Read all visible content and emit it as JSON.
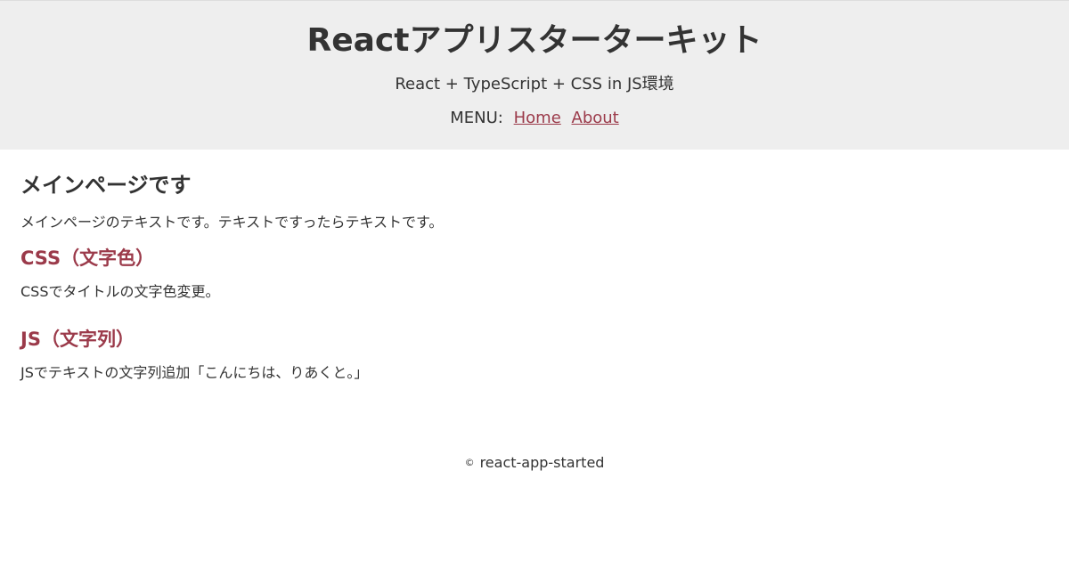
{
  "header": {
    "title": "Reactアプリスターターキット",
    "subtitle": "React + TypeScript + CSS in JS環境",
    "menu_label": "MENU:",
    "menu_items": [
      {
        "label": "Home"
      },
      {
        "label": "About"
      }
    ]
  },
  "main": {
    "page_title": "メインページです",
    "intro": "メインページのテキストです。テキストですったらテキストです。",
    "sections": [
      {
        "title": "CSS（文字色）",
        "text": "CSSでタイトルの文字色変更。"
      },
      {
        "title": "JS（文字列）",
        "text": "JSでテキストの文字列追加「こんにちは、りあくと。」"
      }
    ]
  },
  "footer": {
    "copyright_symbol": "©",
    "text": "react-app-started"
  },
  "colors": {
    "header_background": "#eeeeee",
    "text": "#333333",
    "accent": "#9b3a4a"
  }
}
